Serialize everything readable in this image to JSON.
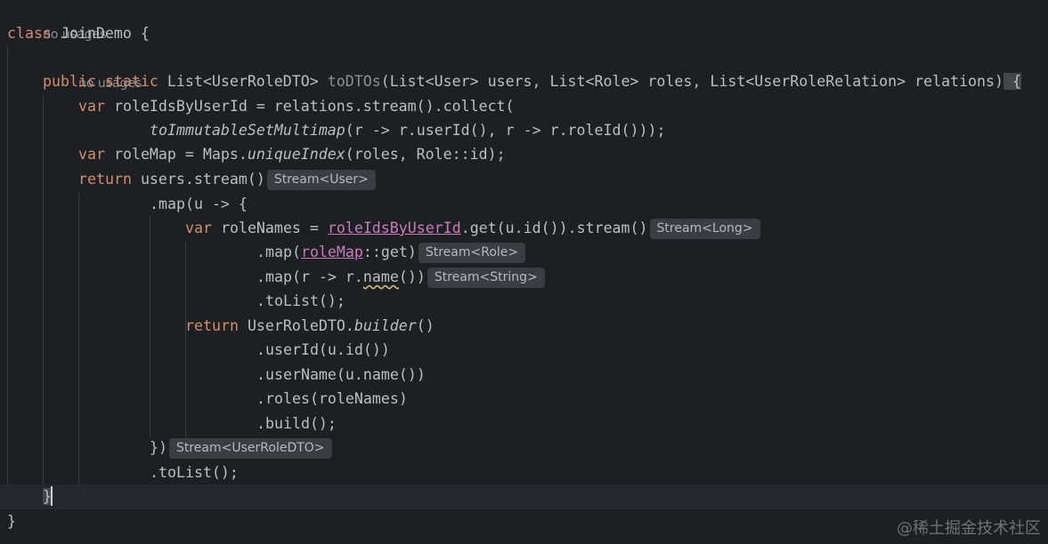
{
  "usage_hint": "no usages",
  "inlay_hints": {
    "stream_user": "Stream<User>",
    "stream_long": "Stream<Long>",
    "stream_role": "Stream<Role>",
    "stream_string": "Stream<String>",
    "stream_dto": "Stream<UserRoleDTO>"
  },
  "code": {
    "class_kw": "class",
    "class_name": "JoinDemo",
    "open_brace": " {",
    "public_kw": "public",
    "static_kw": "static",
    "return_type": "List<UserRoleDTO>",
    "method_name": "toDTOs",
    "params": "(List<User> users, List<Role> roles, List<UserRoleRelation> relations)",
    "method_open": " {",
    "var_kw": "var",
    "l4_rest": " roleIdsByUserId = relations.stream().collect(",
    "l5_fn": "toImmutableSetMultimap",
    "l5_rest": "(r -> r.userId(), r -> r.roleId()));",
    "l6_a": " roleMap = Maps.",
    "l6_fn": "uniqueIndex",
    "l6_rest": "(roles, Role::id);",
    "return_kw": "return",
    "l7_rest": " users.stream()",
    "l8": ".map(u -> {",
    "l9_a": " roleNames = ",
    "l9_ref": "roleIdsByUserId",
    "l9_rest": ".get(u.id()).stream()",
    "l10_a": ".map(",
    "l10_ref": "roleMap",
    "l10_rest": "::get)",
    "l11_a": ".map(r -> r.",
    "l11_name": "name",
    "l11_rest": "())",
    "l12": ".toList();",
    "l13_a": " UserRoleDTO.",
    "l13_fn": "builder",
    "l13_rest": "()",
    "l14": ".userId(u.id())",
    "l15": ".userName(u.name())",
    "l16": ".roles(roleNames)",
    "l17": ".build();",
    "l18": "})",
    "l19": ".toList();",
    "method_close": "}",
    "class_close": "}"
  },
  "watermark": "@稀土掘金技术社区"
}
